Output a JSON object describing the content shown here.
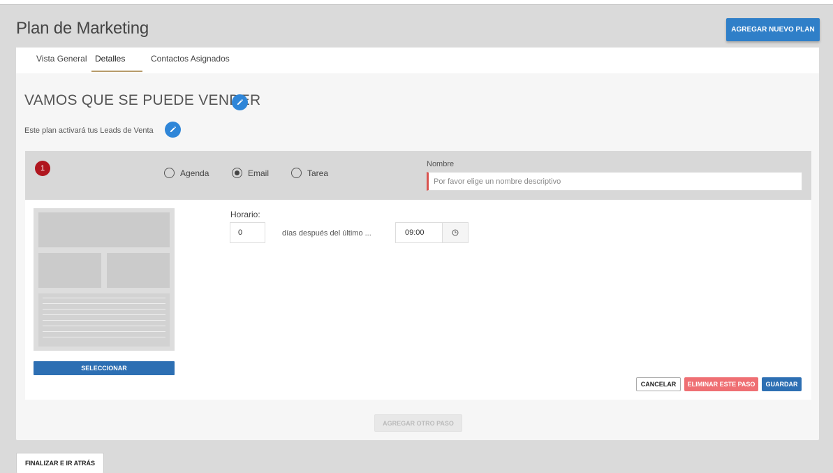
{
  "header": {
    "title": "Plan de Marketing",
    "add_plan_label": "AGREGAR NUEVO PLAN"
  },
  "tabs": [
    {
      "label": "Vista General"
    },
    {
      "label": "Detalles",
      "active": true
    },
    {
      "label": "Contactos Asignados"
    }
  ],
  "plan": {
    "name": "VAMOS QUE SE PUEDE VENDER",
    "description": "Este plan activará tus Leads de Venta"
  },
  "step": {
    "number": "1",
    "types": [
      {
        "label": "Agenda",
        "selected": false
      },
      {
        "label": "Email",
        "selected": true
      },
      {
        "label": "Tarea",
        "selected": false
      }
    ],
    "name_label": "Nombre",
    "name_placeholder": "Por favor elige un nombre descriptivo",
    "name_value": "",
    "schedule_label": "Horario:",
    "days_value": "0",
    "days_text": "días después del último ...",
    "time_value": "09:00",
    "select_label": "SELECCIONAR",
    "cancel_label": "CANCELAR",
    "delete_label": "ELIMINAR ESTE PASO",
    "save_label": "GUARDAR"
  },
  "add_step_label": "AGREGAR OTRO PASO",
  "finish_label": "FINALIZAR E IR ATRÁS",
  "colors": {
    "primary": "#2f7fc8",
    "danger": "#ef6f73",
    "step_badge": "#b0161f",
    "tab_underline": "#b79b6a"
  }
}
